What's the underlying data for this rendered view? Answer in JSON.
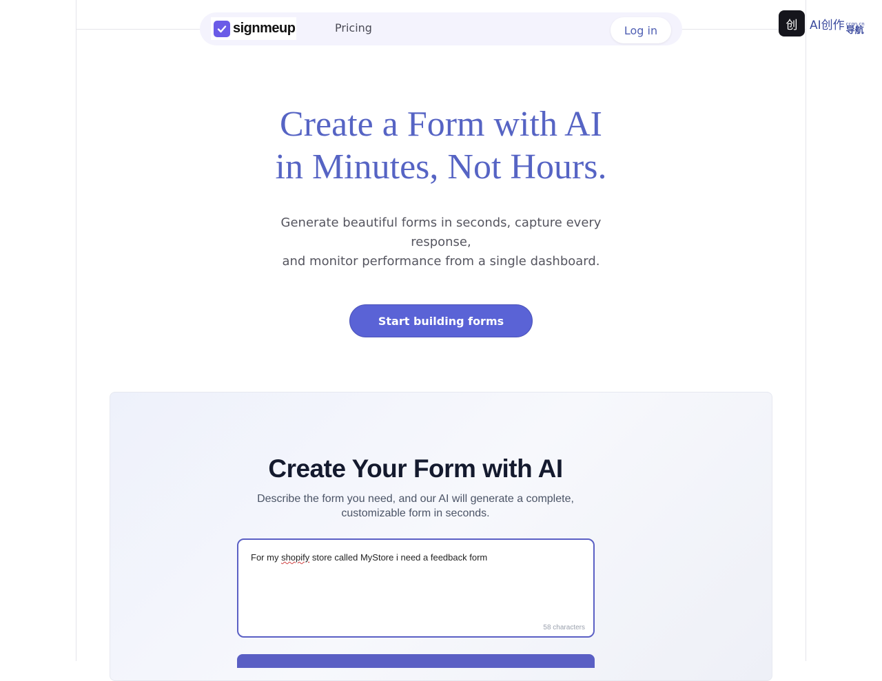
{
  "nav": {
    "logo_text": "signmeup",
    "pricing_label": "Pricing",
    "login_label": "Log in"
  },
  "badge": {
    "icon_glyph": "创",
    "text": "AI创作",
    "sub_small": "ccgn.cn",
    "sub_text": "导航"
  },
  "hero": {
    "title_line1": "Create a Form with AI",
    "title_line2": "in Minutes, Not Hours.",
    "subtitle_line1": "Generate beautiful forms in seconds, capture every response,",
    "subtitle_line2": "and monitor performance from a single dashboard.",
    "cta_label": "Start building forms"
  },
  "builder": {
    "title": "Create Your Form with AI",
    "description": "Describe the form you need, and our AI will generate a complete, customizable form in seconds.",
    "prompt": {
      "before": "For my ",
      "misspelled": "shopify",
      "after": " store called MyStore i need a feedback form"
    },
    "char_count": "58 characters"
  },
  "colors": {
    "accent": "#5a63d6",
    "hero_title": "#5664c4",
    "logo_mark": "#6b5ce7"
  }
}
